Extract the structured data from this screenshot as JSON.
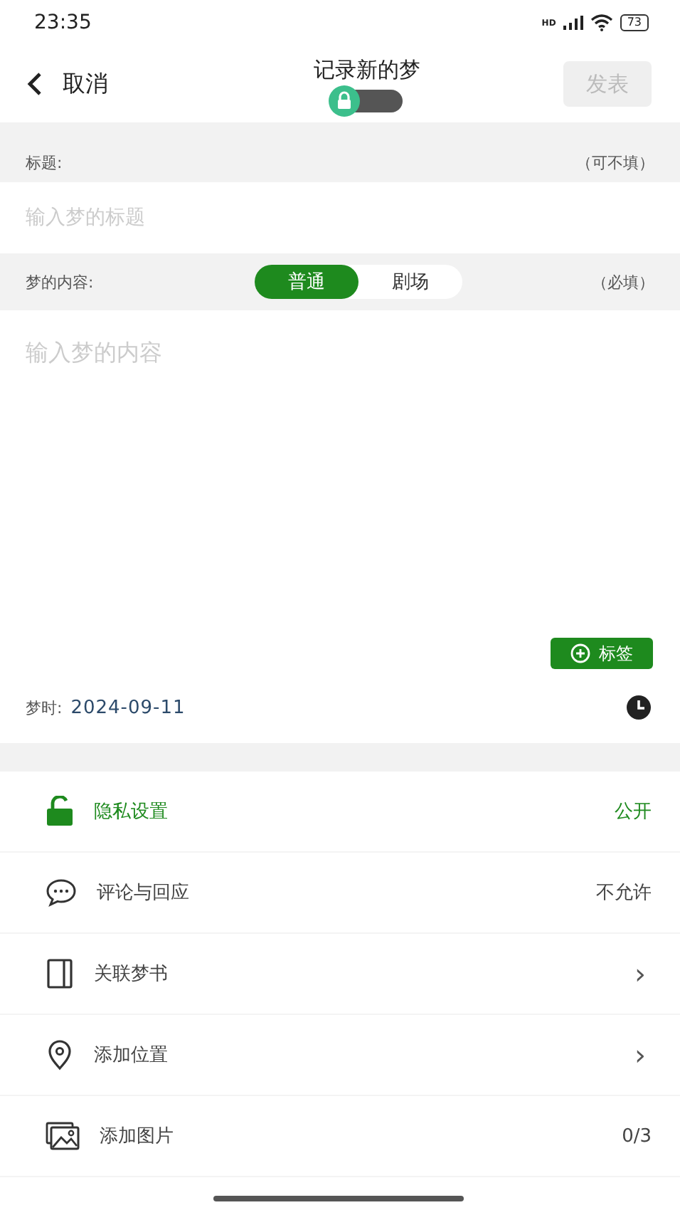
{
  "status_bar": {
    "time": "23:35",
    "network": "HD",
    "battery": "73"
  },
  "header": {
    "back": "取消",
    "title": "记录新的梦",
    "lock_toggle": {
      "on": false
    },
    "publish": {
      "label": "发表",
      "disabled": true
    }
  },
  "title_section": {
    "label": "标题:",
    "hint": "（可不填）",
    "placeholder": "输入梦的标题"
  },
  "content_section": {
    "label": "梦的内容:",
    "hint": "（必填）",
    "placeholder": "输入梦的内容",
    "modes": [
      {
        "label": "普通",
        "selected": true
      },
      {
        "label": "剧场",
        "selected": false
      }
    ]
  },
  "tag_button": "标签",
  "date": {
    "label": "梦时:",
    "value": "2024-09-11"
  },
  "settings": [
    {
      "kind": "privacy",
      "label": "隐私设置",
      "value": "公开",
      "highlighted": true
    },
    {
      "kind": "comments",
      "label": "评论与回应",
      "value": "不允许",
      "highlighted": false
    },
    {
      "kind": "book",
      "label": "关联梦书",
      "chevron": "›",
      "highlighted": false
    },
    {
      "kind": "location",
      "label": "添加位置",
      "chevron": "›",
      "highlighted": false
    },
    {
      "kind": "images",
      "label": "添加图片",
      "value": "0/3",
      "highlighted": false
    }
  ]
}
